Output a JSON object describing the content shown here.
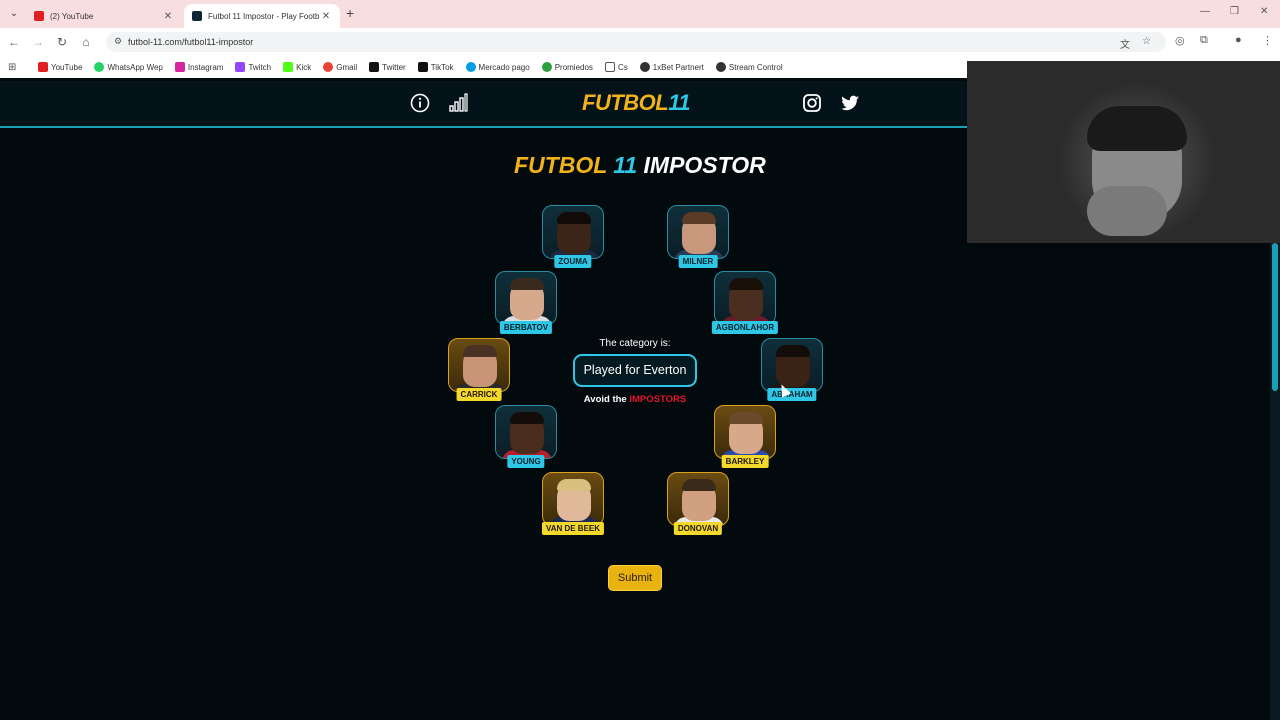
{
  "browser": {
    "tabs": [
      {
        "title": "(2) YouTube",
        "active": false,
        "favicon": "youtube-icon"
      },
      {
        "title": "Futbol 11 Impostor - Play Footb",
        "active": true,
        "favicon": "futbol11-icon"
      }
    ],
    "url": "futbol-11.com/futbol11-impostor",
    "bookmarks": [
      {
        "label": "YouTube",
        "color": "#e02020"
      },
      {
        "label": "WhatsApp Wep",
        "color": "#25d366"
      },
      {
        "label": "Instagram",
        "color": "#d6249f"
      },
      {
        "label": "Twitch",
        "color": "#9146ff"
      },
      {
        "label": "Kick",
        "color": "#53fc18"
      },
      {
        "label": "Gmail",
        "color": "#ea4335"
      },
      {
        "label": "Twitter",
        "color": "#111111"
      },
      {
        "label": "TikTok",
        "color": "#111111"
      },
      {
        "label": "Mercado pago",
        "color": "#009ee3"
      },
      {
        "label": "Promiedos",
        "color": "#2e9e3e"
      },
      {
        "label": "Cs",
        "color": "#888888"
      },
      {
        "label": "1xBet Partnert",
        "color": "#333333"
      },
      {
        "label": "Stream Control",
        "color": "#333333"
      }
    ]
  },
  "site": {
    "logo_part1": "FUTBOL",
    "logo_part2": "11",
    "title_part1": "FUTBOL",
    "title_part2": "11",
    "title_part3": "IMPOSTOR",
    "category_label": "The category is:",
    "category_value": "Played for Everton",
    "avoid_text": "Avoid the",
    "avoid_highlight": "IMPOSTORS",
    "submit_label": "Submit"
  },
  "players": [
    {
      "name": "ZOUMA",
      "selected": false,
      "skin": "#3b2418",
      "hair": "#120a06",
      "shirt": "#1e2a44"
    },
    {
      "name": "MILNER",
      "selected": false,
      "skin": "#c9987c",
      "hair": "#5a3b25",
      "shirt": "#2b3b5a"
    },
    {
      "name": "BERBATOV",
      "selected": false,
      "skin": "#d6a88c",
      "hair": "#3a2a1e",
      "shirt": "#dcdcdc"
    },
    {
      "name": "AGBONLAHOR",
      "selected": false,
      "skin": "#4a2e20",
      "hair": "#1a100a",
      "shirt": "#6a1a2a"
    },
    {
      "name": "CARRICK",
      "selected": true,
      "skin": "#c89476",
      "hair": "#4a3222",
      "shirt": "#2a2a2a"
    },
    {
      "name": "ABRAHAM",
      "selected": false,
      "skin": "#3a2216",
      "hair": "#140c08",
      "shirt": "#1a1a1a"
    },
    {
      "name": "YOUNG",
      "selected": false,
      "skin": "#4a2c1c",
      "hair": "#140c08",
      "shirt": "#b81e2a"
    },
    {
      "name": "BARKLEY",
      "selected": true,
      "skin": "#d8a88a",
      "hair": "#6a4a2a",
      "shirt": "#2a4ab0"
    },
    {
      "name": "VAN DE BEEK",
      "selected": true,
      "skin": "#e0b89a",
      "hair": "#d8c080",
      "shirt": "#1a2a55"
    },
    {
      "name": "DONOVAN",
      "selected": true,
      "skin": "#d0a080",
      "hair": "#3a2a1a",
      "shirt": "#e8e8e8"
    }
  ]
}
